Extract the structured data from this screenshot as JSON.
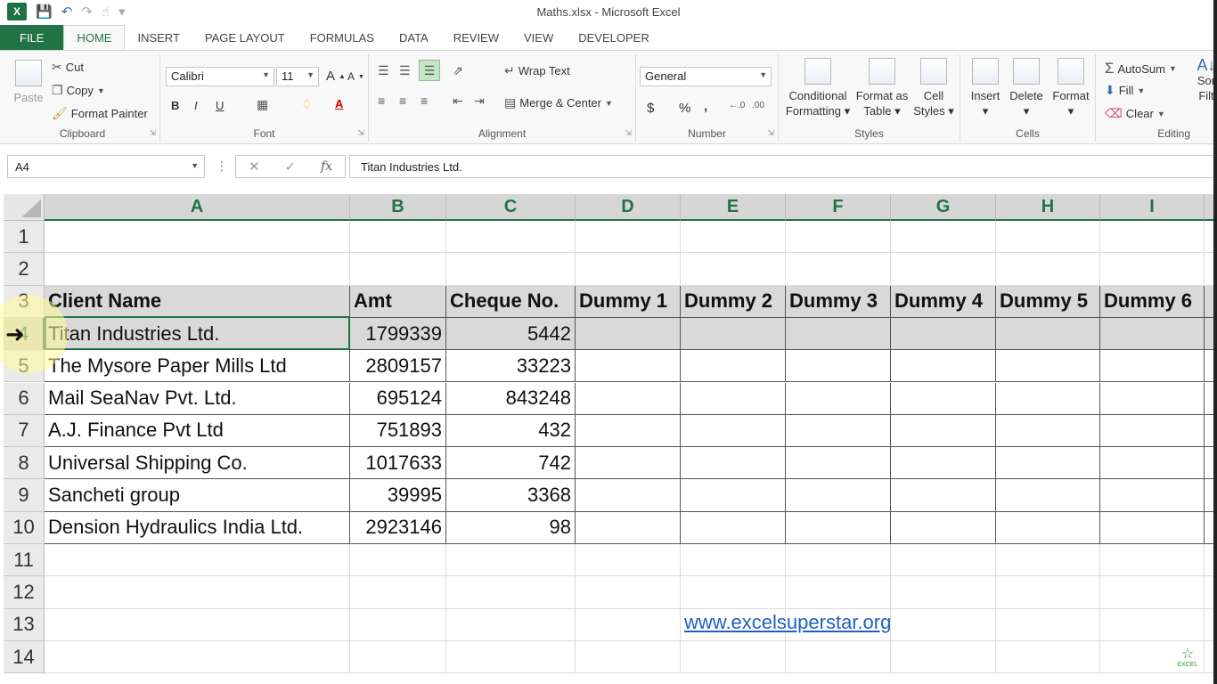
{
  "app": {
    "window_title": "Maths.xlsx - Microsoft Excel"
  },
  "tabs": [
    {
      "label": "FILE"
    },
    {
      "label": "HOME"
    },
    {
      "label": "INSERT"
    },
    {
      "label": "PAGE LAYOUT"
    },
    {
      "label": "FORMULAS"
    },
    {
      "label": "DATA"
    },
    {
      "label": "REVIEW"
    },
    {
      "label": "VIEW"
    },
    {
      "label": "DEVELOPER"
    }
  ],
  "ribbon": {
    "clipboard": {
      "paste": "Paste",
      "cut": "Cut",
      "copy": "Copy",
      "format_painter": "Format Painter",
      "label": "Clipboard"
    },
    "font": {
      "name": "Calibri",
      "size": "11",
      "label": "Font",
      "bold": "B",
      "italic": "I",
      "underline": "U",
      "grow": "A",
      "shrink": "A",
      "font_color": "A"
    },
    "alignment": {
      "wrap": "Wrap Text",
      "merge": "Merge & Center",
      "label": "Alignment"
    },
    "number": {
      "format": "General",
      "currency": "$",
      "percent": "%",
      "comma": ",",
      "label": "Number"
    },
    "styles": {
      "conditional_1": "Conditional",
      "conditional_2": "Formatting",
      "format_table_1": "Format as",
      "format_table_2": "Table",
      "cell_styles_1": "Cell",
      "cell_styles_2": "Styles",
      "label": "Styles"
    },
    "cells": {
      "insert": "Insert",
      "delete": "Delete",
      "format": "Format",
      "label": "Cells"
    },
    "editing": {
      "autosum": "AutoSum",
      "fill": "Fill",
      "clear": "Clear",
      "sort_1": "Sor",
      "sort_2": "Filt",
      "label": "Editing"
    }
  },
  "formula_bar": {
    "name_box": "A4",
    "fx": "fx",
    "content": "Titan Industries Ltd."
  },
  "columns": [
    "A",
    "B",
    "C",
    "D",
    "E",
    "F",
    "G",
    "H",
    "I"
  ],
  "rows": [
    "1",
    "2",
    "3",
    "4",
    "5",
    "6",
    "7",
    "8",
    "9",
    "10",
    "11",
    "12",
    "13",
    "14"
  ],
  "table": {
    "headers": [
      "Client Name",
      "Amt",
      "Cheque No.",
      "Dummy 1",
      "Dummy 2",
      "Dummy 3",
      "Dummy 4",
      "Dummy 5",
      "Dummy 6"
    ],
    "rows": [
      [
        "Titan Industries Ltd.",
        "1799339",
        "5442"
      ],
      [
        "The Mysore Paper Mills Ltd",
        "2809157",
        "33223"
      ],
      [
        "Mail SeaNav Pvt. Ltd.",
        "695124",
        "843248"
      ],
      [
        "A.J. Finance Pvt Ltd",
        "751893",
        "432"
      ],
      [
        "Universal Shipping Co.",
        "1017633",
        "742"
      ],
      [
        "Sancheti group",
        "39995",
        "3368"
      ],
      [
        "Dension Hydraulics India Ltd.",
        "2923146",
        "98"
      ]
    ]
  },
  "link_text": "www.excelsuperstar.org",
  "watermark": "EXCEL"
}
